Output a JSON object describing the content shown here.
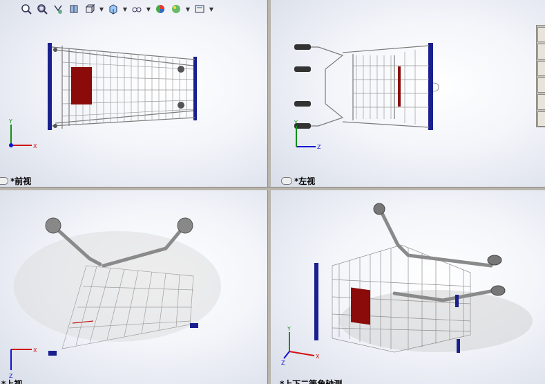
{
  "toolbar": {
    "buttons": [
      {
        "icon": "zoom-to-fit-icon",
        "has_dropdown": false
      },
      {
        "icon": "zoom-to-area-icon",
        "has_dropdown": false
      },
      {
        "icon": "previous-view-icon",
        "has_dropdown": false
      },
      {
        "icon": "section-view-icon",
        "has_dropdown": false
      },
      {
        "icon": "view-orientation-icon",
        "has_dropdown": true
      },
      {
        "icon": "display-style-icon",
        "has_dropdown": true
      },
      {
        "icon": "hide-show-items-icon",
        "has_dropdown": true
      },
      {
        "icon": "edit-appearance-icon",
        "has_dropdown": false
      },
      {
        "icon": "apply-scene-icon",
        "has_dropdown": true
      },
      {
        "icon": "view-settings-icon",
        "has_dropdown": true
      }
    ]
  },
  "viewports": {
    "front": {
      "label": "*前视",
      "triad": {
        "x": "X",
        "y": "Y"
      }
    },
    "left": {
      "label": "*左视",
      "triad": {
        "y": "Y",
        "z": "Z"
      }
    },
    "top": {
      "label": "*上视",
      "triad": {
        "x": "X",
        "z": "Z"
      }
    },
    "iso": {
      "label": "*上下二等角轴测",
      "triad": {
        "x": "X",
        "y": "Y",
        "z": "Z"
      }
    }
  },
  "colors": {
    "frame_blue": "#1a1f8f",
    "basket_red": "#8b0a0a",
    "wire_gray": "#7d7d7d",
    "axis_x": "#d01010",
    "axis_y": "#109010",
    "axis_z": "#1010d0"
  },
  "taskpane": {
    "tabs": [
      "home-icon",
      "design-library-icon",
      "file-explorer-icon",
      "view-palette-icon",
      "appearances-icon",
      "custom-properties-icon"
    ]
  }
}
